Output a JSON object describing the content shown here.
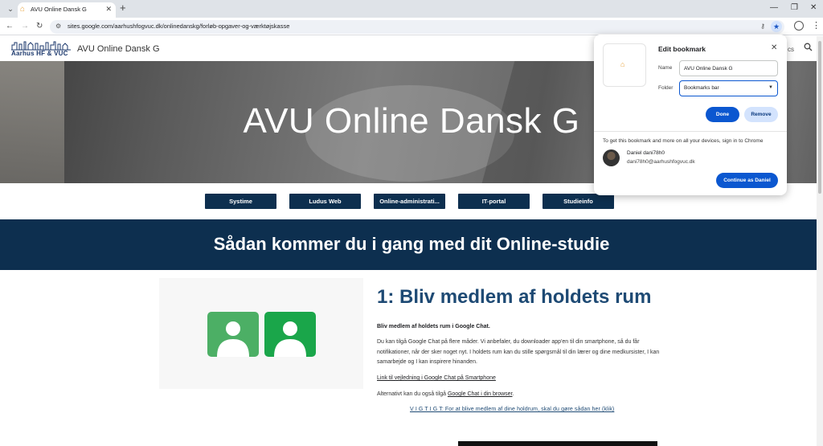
{
  "browser": {
    "tab_title": "AVU Online Dansk G",
    "url": "sites.google.com/aarhushfogvuc.dk/onlinedanskg/forløb-opgaver-og-værktøjskasse",
    "icons": {
      "tab_menu": "chevron-down-icon",
      "favicon": "aarhus-logo-icon",
      "tab_close": "close-icon",
      "new_tab": "plus-icon",
      "back": "arrow-left-icon",
      "forward": "arrow-right-icon",
      "reload": "reload-icon",
      "site_info": "tune-icon",
      "passwords": "key-icon",
      "bookmark": "star-icon",
      "profile": "person-icon",
      "menu": "kebab-icon"
    }
  },
  "site": {
    "logo_text": "Aarhus HF & VUC",
    "name": "AVU Online Dansk G",
    "nav_fragment": "cs",
    "hero_title": "AVU Online Dansk G",
    "buttons": [
      "Systime",
      "Ludus Web",
      "Online-administrati...",
      "IT-portal",
      "Studieinfo"
    ],
    "band_title": "Sådan kommer du i gang med dit Online-studie"
  },
  "section": {
    "title": "1: Bliv medlem af holdets rum",
    "bold_intro": "Bliv medlem af holdets rum i Google Chat.",
    "body": "Du kan tilgå Google Chat på flere måder. Vi anbefaler, du downloader app'en til din smartphone, så du får notifikationer, når der sker noget nyt. I holdets rum kan du stille spørgsmål til din lærer og dine medkursister, I kan samarbejde og I kan inspirere hinanden.",
    "link_smartphone": "Link til vejledning i Google Chat på Smartphone",
    "alt_text": "Alternativt kan du også tilgå ",
    "alt_link": "Google Chat i din browser",
    "alt_suffix": ".",
    "vigtigt": "V I G T I G T: For at blive medlem af dine holdrum, skal du gøre sådan her (klik)"
  },
  "bookmark_popup": {
    "heading": "Edit bookmark",
    "name_label": "Name",
    "name_value": "AVU Online Dansk G",
    "folder_label": "Folder",
    "folder_value": "Bookmarks bar",
    "done_label": "Done",
    "remove_label": "Remove",
    "sync_text": "To get this bookmark and more on all your devices, sign in to Chrome",
    "account_name": "Daniel dani78h0",
    "account_email": "dani78h0@aarhushfogvuc.dk",
    "continue_label": "Continue as Daniel"
  },
  "colors": {
    "navy": "#0d2f4f",
    "title_blue": "#1e4a74",
    "chrome_blue": "#0b57d0",
    "green_light": "#4caf65",
    "green_dark": "#1aa64a"
  }
}
